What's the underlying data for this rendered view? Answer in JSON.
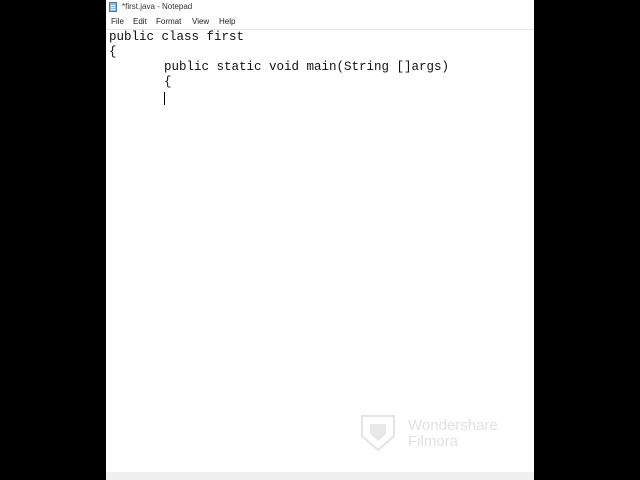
{
  "window": {
    "title": "*first.java - Notepad"
  },
  "menu": {
    "file": "File",
    "edit": "Edit",
    "format": "Format",
    "view": "View",
    "help": "Help"
  },
  "editor": {
    "lines": [
      "public class first",
      "{",
      "public static void main(String []args)",
      "{"
    ]
  },
  "watermark": {
    "text_line_1": "Wondershare",
    "text_line_2": "Filmora"
  },
  "icons": {
    "app": "notepad-icon",
    "watermark": "filmora-logo-icon"
  }
}
